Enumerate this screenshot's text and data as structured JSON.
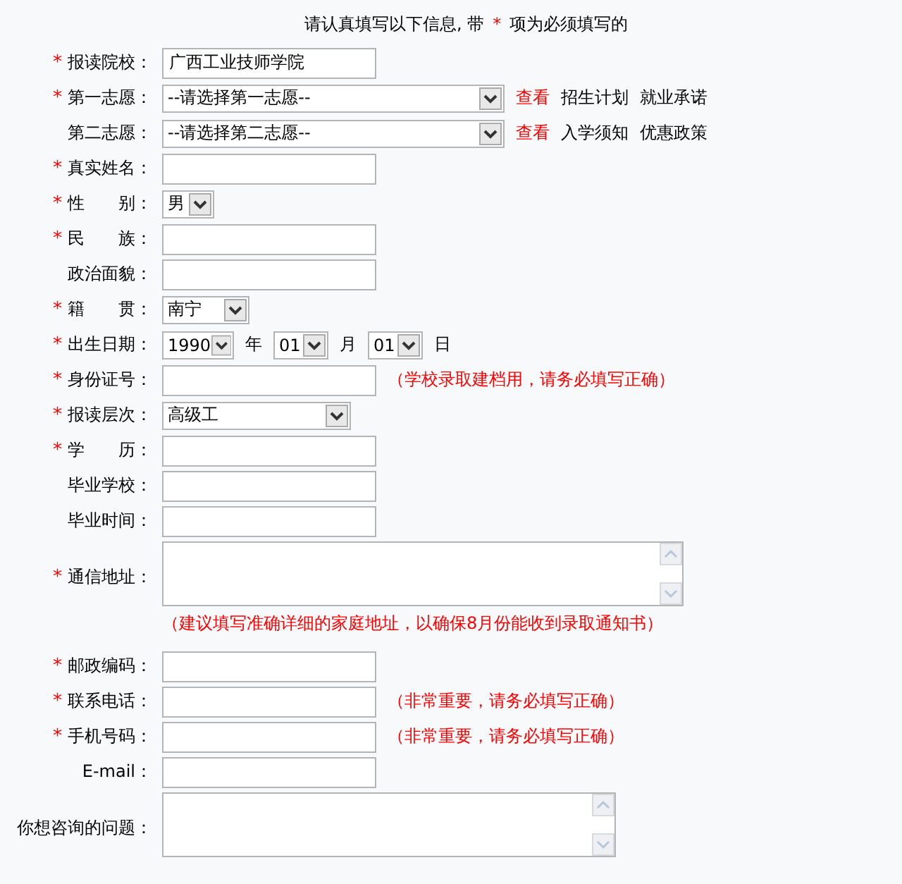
{
  "instruction": {
    "before": "请认真填写以下信息, 带",
    "mark": "*",
    "after": "项为必须填写的"
  },
  "fields": [
    {
      "kind": "text",
      "label": "报读院校：",
      "required": true,
      "value": "广西工业技师学院"
    },
    {
      "kind": "select",
      "label": "第一志愿：",
      "required": true,
      "value": "--请选择第一志愿--",
      "links": [
        {
          "text": "查看",
          "highlight": true
        },
        {
          "text": "招生计划",
          "highlight": false
        },
        {
          "text": "就业承诺",
          "highlight": false
        }
      ]
    },
    {
      "kind": "select",
      "label": "第二志愿：",
      "required": false,
      "value": "--请选择第二志愿--",
      "links": [
        {
          "text": "查看",
          "highlight": true
        },
        {
          "text": "入学须知",
          "highlight": false
        },
        {
          "text": "优惠政策",
          "highlight": false
        }
      ]
    },
    {
      "kind": "text",
      "label": "真实姓名：",
      "required": true
    },
    {
      "kind": "select",
      "label": "性　　别：",
      "required": true,
      "value": "男"
    },
    {
      "kind": "text",
      "label": "民　　族：",
      "required": true
    },
    {
      "kind": "text",
      "label": "政治面貌：",
      "required": false
    },
    {
      "kind": "select",
      "label": "籍　　贯：",
      "required": true,
      "value": "南宁"
    },
    {
      "kind": "date",
      "label": "出生日期：",
      "required": true,
      "parts": [
        {
          "value": "1990",
          "unit": "年"
        },
        {
          "value": "01",
          "unit": "月"
        },
        {
          "value": "01",
          "unit": "日"
        }
      ]
    },
    {
      "kind": "text",
      "label": "身份证号：",
      "required": true,
      "note": "（学校录取建档用，请务必填写正确）"
    },
    {
      "kind": "select",
      "label": "报读层次：",
      "required": true,
      "value": "高级工"
    },
    {
      "kind": "text",
      "label": "学　　历：",
      "required": true
    },
    {
      "kind": "text",
      "label": "毕业学校：",
      "required": false
    },
    {
      "kind": "text",
      "label": "毕业时间：",
      "required": false
    },
    {
      "kind": "textarea",
      "label": "通信地址：",
      "required": true,
      "note": "（建议填写准确详细的家庭地址，以确保8月份能收到录取通知书）"
    },
    {
      "kind": "text",
      "label": "邮政编码：",
      "required": true
    },
    {
      "kind": "text",
      "label": "联系电话：",
      "required": true,
      "note": "（非常重要，请务必填写正确）"
    },
    {
      "kind": "text",
      "label": "手机号码：",
      "required": true,
      "note": "（非常重要，请务必填写正确）"
    },
    {
      "kind": "text",
      "label": "E-mail：",
      "required": false
    },
    {
      "kind": "textarea",
      "label": "你想咨询的问题：",
      "required": false
    }
  ]
}
